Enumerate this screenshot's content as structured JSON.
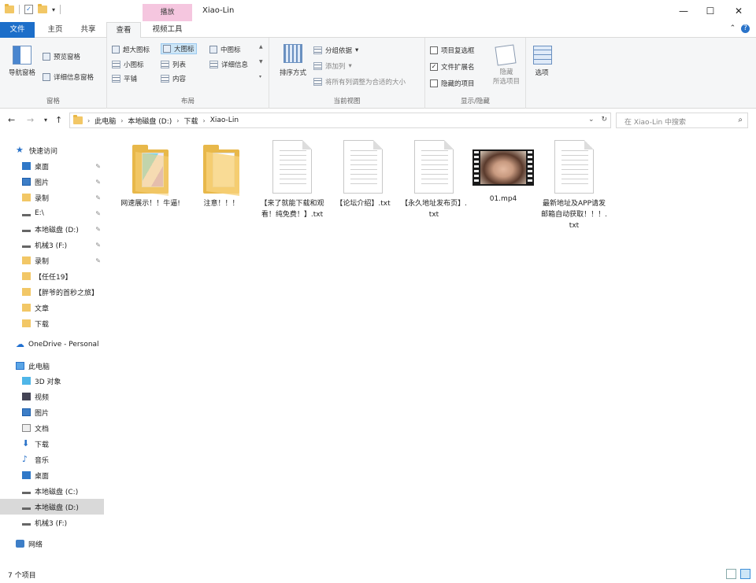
{
  "window": {
    "title": "Xiao-Lin",
    "context_tab": "播放",
    "min": "—",
    "max": "☐",
    "close": "✕"
  },
  "tabs": [
    {
      "label": "文件"
    },
    {
      "label": "主页"
    },
    {
      "label": "共享"
    },
    {
      "label": "查看"
    },
    {
      "label": "视频工具"
    }
  ],
  "ribbon": {
    "help": "?",
    "panes": {
      "nav_pane": "导航窗格",
      "preview": "预览窗格",
      "details": "详细信息窗格",
      "label": "窗格"
    },
    "layout": {
      "items": [
        "超大图标",
        "大图标",
        "中图标",
        "小图标",
        "列表",
        "详细信息",
        "平铺",
        "内容"
      ],
      "label": "布局"
    },
    "current_view": {
      "sort": "排序方式",
      "group": "分组依据",
      "add_col": "添加列",
      "fit_cols": "将所有列调整为合适的大小",
      "label": "当前视图"
    },
    "show_hide": {
      "item_checkbox": "项目复选框",
      "extensions": "文件扩展名",
      "hidden_items": "隐藏的项目",
      "hide": "隐藏",
      "selected": "所选项目",
      "label": "显示/隐藏"
    },
    "options": "选项"
  },
  "address": {
    "crumbs": [
      "此电脑",
      "本地磁盘 (D:)",
      "下载",
      "Xiao-Lin"
    ],
    "search_placeholder": "在 Xiao-Lin 中搜索"
  },
  "nav": [
    {
      "label": "快速访问",
      "icon": "star-icon"
    },
    {
      "label": "桌面",
      "icon": "desktop-icon",
      "pinned": true
    },
    {
      "label": "图片",
      "icon": "pictures-icon",
      "pinned": true
    },
    {
      "label": "录制",
      "icon": "folder-icon",
      "pinned": true
    },
    {
      "label": "E:\\",
      "icon": "drive-icon",
      "pinned": true
    },
    {
      "label": "本地磁盘 (D:)",
      "icon": "drive-icon",
      "pinned": true
    },
    {
      "label": "机械3 (F:)",
      "icon": "drive-icon",
      "pinned": true
    },
    {
      "label": "录制",
      "icon": "folder-icon",
      "pinned": true
    },
    {
      "label": "【任任19】",
      "icon": "folder-icon"
    },
    {
      "label": "【胖爷的首秒之旅】",
      "icon": "folder-icon"
    },
    {
      "label": "文章",
      "icon": "folder-icon"
    },
    {
      "label": "下载",
      "icon": "folder-icon"
    },
    {
      "label": "OneDrive - Personal",
      "icon": "cloud-icon"
    },
    {
      "label": "此电脑",
      "icon": "computer-icon"
    },
    {
      "label": "3D 对象",
      "icon": "3d-objects-icon"
    },
    {
      "label": "视频",
      "icon": "videos-icon"
    },
    {
      "label": "图片",
      "icon": "pictures-icon"
    },
    {
      "label": "文档",
      "icon": "documents-icon"
    },
    {
      "label": "下载",
      "icon": "downloads-icon"
    },
    {
      "label": "音乐",
      "icon": "music-icon"
    },
    {
      "label": "桌面",
      "icon": "desktop-icon"
    },
    {
      "label": "本地磁盘 (C:)",
      "icon": "drive-icon"
    },
    {
      "label": "本地磁盘 (D:)",
      "icon": "drive-icon",
      "selected": true
    },
    {
      "label": "机械3 (F:)",
      "icon": "drive-icon"
    },
    {
      "label": "网络",
      "icon": "network-icon"
    }
  ],
  "files": [
    {
      "name": "网速展示！！牛逼!",
      "type": "folder-colorful"
    },
    {
      "name": "注意！！！",
      "type": "folder"
    },
    {
      "name": "【来了就能下载和观看！纯免费！】.txt",
      "type": "txt"
    },
    {
      "name": "【论坛介绍】.txt",
      "type": "txt"
    },
    {
      "name": "【永久地址发布页】.txt",
      "type": "txt"
    },
    {
      "name": "01.mp4",
      "type": "video"
    },
    {
      "name": "最新地址及APP请发邮箱自动获取！！！.txt",
      "type": "txt"
    }
  ],
  "status": {
    "count": "7 个项目"
  }
}
